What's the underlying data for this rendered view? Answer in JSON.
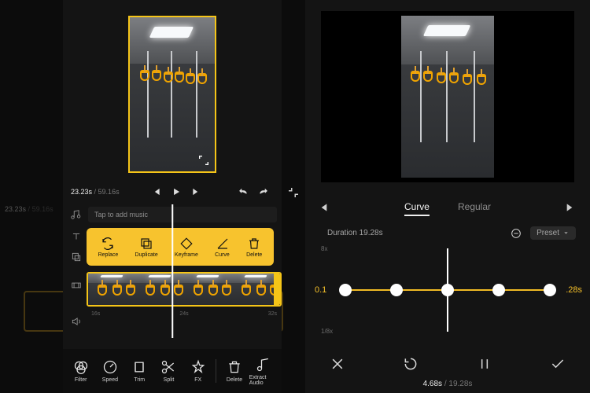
{
  "left": {
    "time_current": "23.23s",
    "time_total": "59.16s",
    "music_hint": "Tap to add music",
    "popup_tools": {
      "replace": "Replace",
      "duplicate": "Duplicate",
      "keyframe": "Keyframe",
      "curve": "Curve",
      "delete": "Delete"
    },
    "ruler": {
      "t0": "16s",
      "t1": "24s",
      "t2": "32s"
    },
    "bottom_tools": {
      "filter": "Filter",
      "speed": "Speed",
      "trim": "Trim",
      "split": "Split",
      "fx": "FX",
      "delete": "Delete",
      "extract": "Extract Audio"
    }
  },
  "right": {
    "tabs": {
      "curve": "Curve",
      "regular": "Regular"
    },
    "duration_label": "Duration 19.28s",
    "preset_label": "Preset",
    "y_top": "8x",
    "y_bottom": "1/8x",
    "x_left": "0.1",
    "x_right": ".28s",
    "bottom_current": "4.68s",
    "bottom_total": "19.28s"
  }
}
